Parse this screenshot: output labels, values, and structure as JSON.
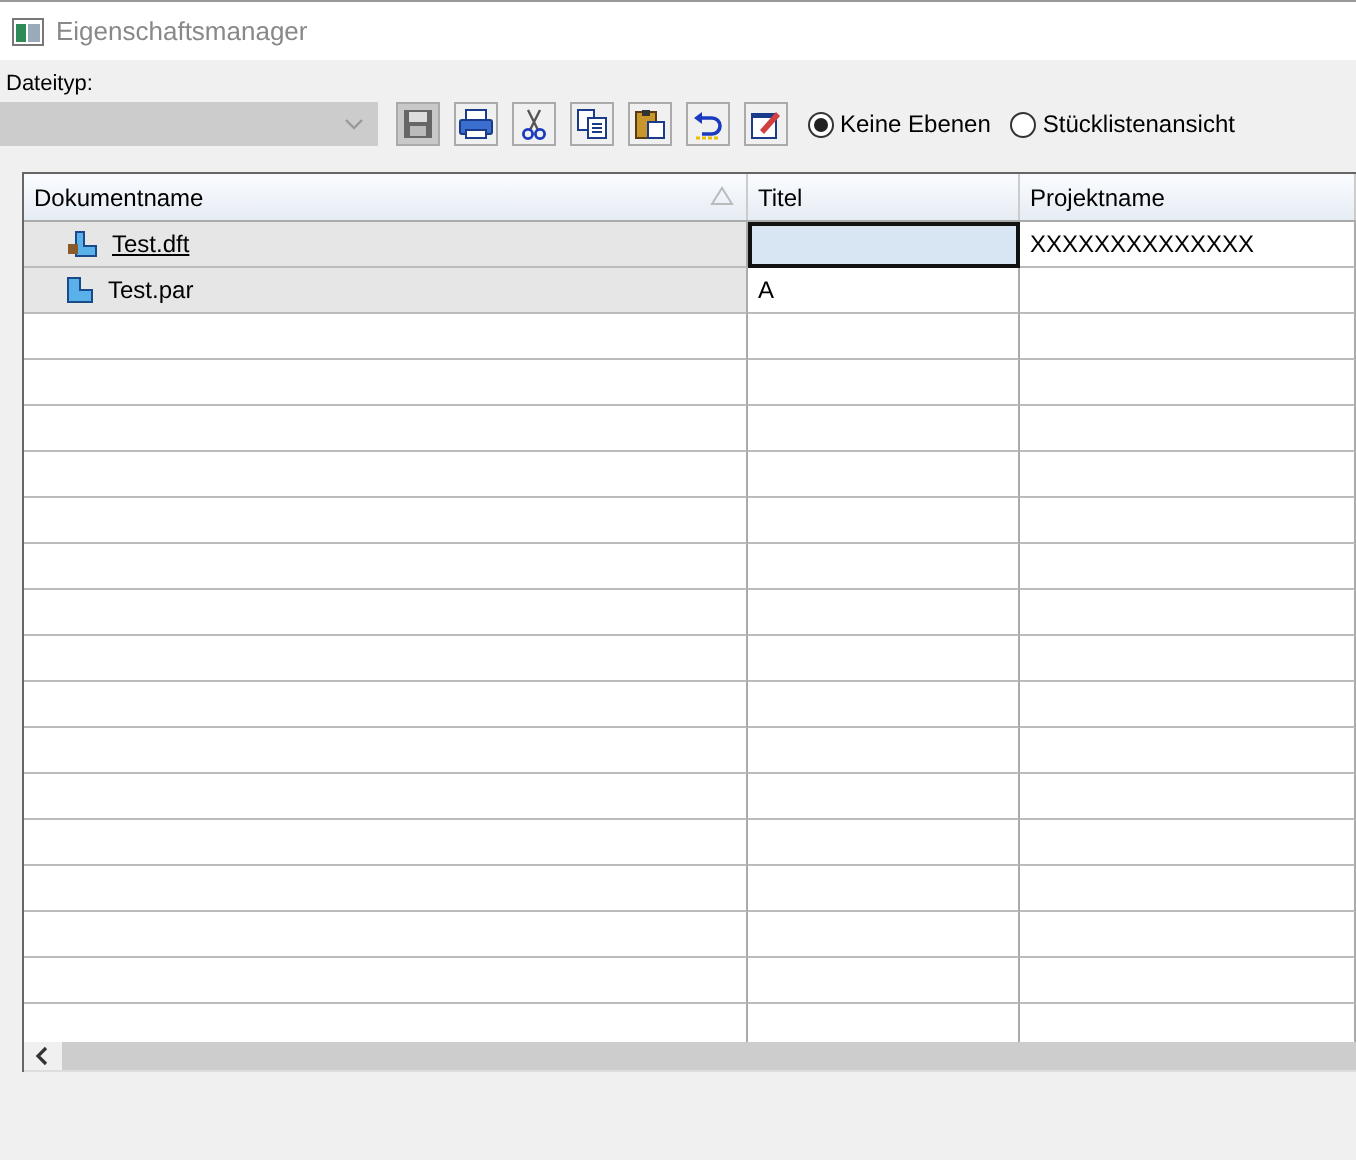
{
  "window": {
    "title": "Eigenschaftsmanager"
  },
  "file_type": {
    "label": "Dateityp:",
    "disabled": true
  },
  "toolbar": [
    {
      "kind": "save",
      "pressed": true
    },
    {
      "kind": "print",
      "pressed": false
    },
    {
      "kind": "cut",
      "pressed": false
    },
    {
      "kind": "copy",
      "pressed": false
    },
    {
      "kind": "paste",
      "pressed": false
    },
    {
      "kind": "undo",
      "pressed": false
    },
    {
      "kind": "edit",
      "pressed": false
    }
  ],
  "view_options": [
    {
      "label": "Keine Ebenen",
      "selected": true
    },
    {
      "label": "Stücklistenansicht",
      "selected": false
    }
  ],
  "table": {
    "columns": [
      "Dokumentname",
      "Titel",
      "Projektname"
    ],
    "rows": [
      {
        "kind": "drawing",
        "name": "Test.dft",
        "title": "",
        "project": "XXXXXXXXXXXXXX",
        "selected": true
      },
      {
        "kind": "part",
        "name": "Test.par",
        "title": "A",
        "project": "",
        "selected": false
      }
    ]
  }
}
